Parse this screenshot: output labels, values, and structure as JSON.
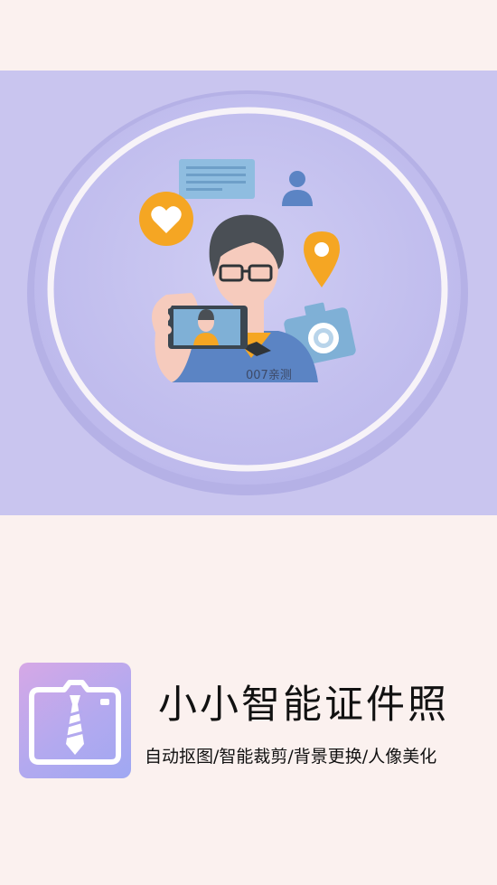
{
  "hero": {
    "watermark": "007亲测"
  },
  "app": {
    "title": "小小智能证件照",
    "subtitle": "自动抠图/智能裁剪/背景更换/人像美化",
    "icon": "camera-tie-icon"
  },
  "colors": {
    "background": "#fbf1ef",
    "hero_background": "#c9c5ef",
    "accent_orange": "#f5a623",
    "shirt_blue": "#5b84c4",
    "camera_blue": "#7fb0d6"
  }
}
